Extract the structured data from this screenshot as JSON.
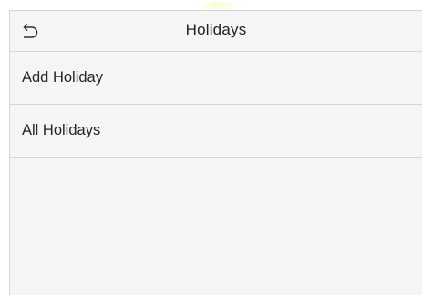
{
  "header": {
    "title": "Holidays",
    "back_icon": "return-arrow-icon"
  },
  "menu": {
    "items": [
      {
        "label": "Add Holiday"
      },
      {
        "label": "All Holidays"
      }
    ]
  }
}
